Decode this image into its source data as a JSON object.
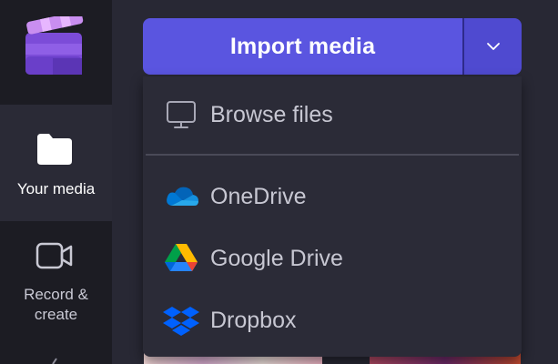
{
  "app": {
    "logo_icon": "clipchamp-logo-icon"
  },
  "sidebar": {
    "items": [
      {
        "label": "Your media",
        "icon": "folder-icon",
        "active": true
      },
      {
        "label": "Record &\ncreate",
        "icon": "video-camera-icon",
        "active": false
      }
    ]
  },
  "import": {
    "button_label": "Import media",
    "dropdown_icon": "chevron-down-icon",
    "menu": [
      {
        "label": "Browse files",
        "icon": "monitor-icon"
      },
      {
        "label": "OneDrive",
        "icon": "onedrive-icon"
      },
      {
        "label": "Google Drive",
        "icon": "google-drive-icon"
      },
      {
        "label": "Dropbox",
        "icon": "dropbox-icon"
      }
    ]
  },
  "colors": {
    "accent": "#5a55e0",
    "rail_bg": "#1c1c23",
    "active_item_bg": "#2a2a36",
    "menu_bg": "#2b2b37"
  }
}
